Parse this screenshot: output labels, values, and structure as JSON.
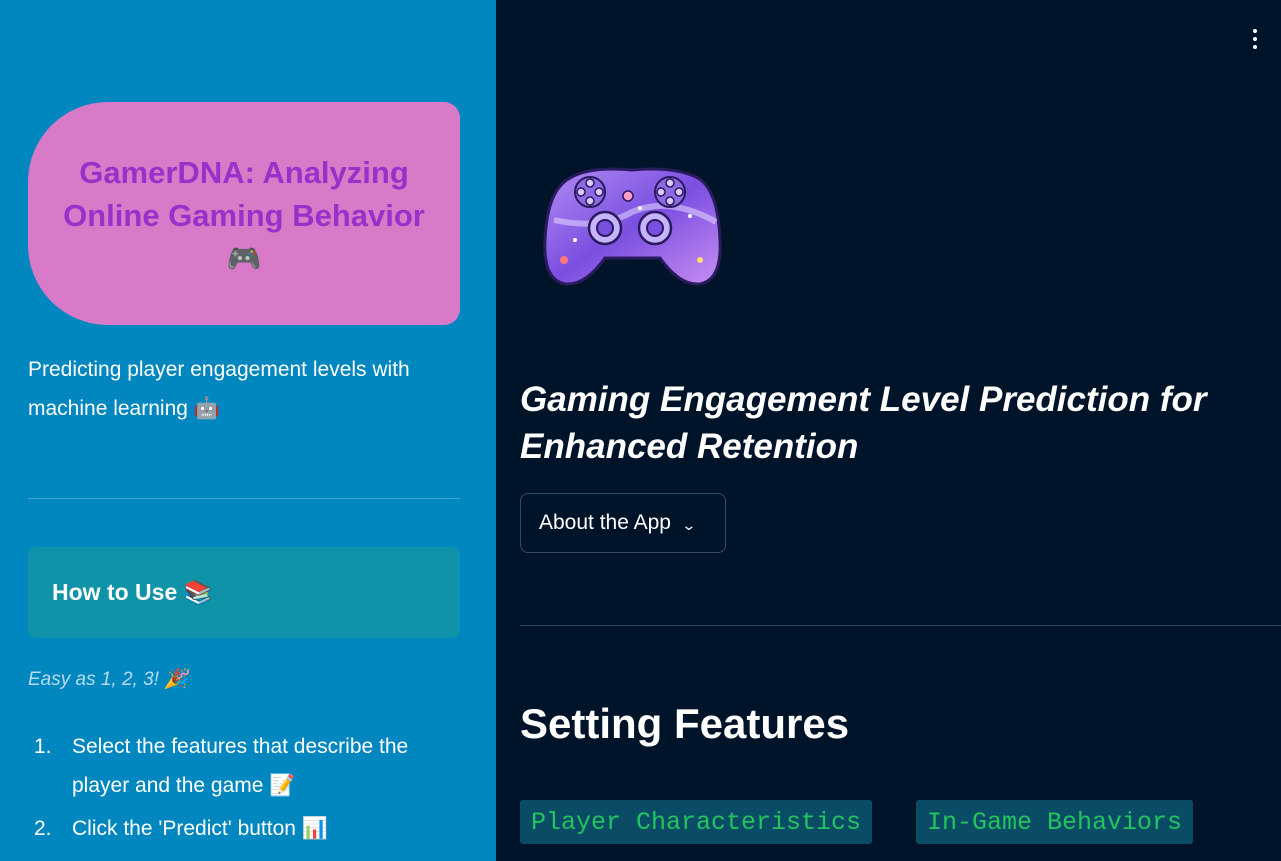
{
  "sidebar": {
    "title": "GamerDNA: Analyzing Online Gaming Behavior",
    "title_emoji": "🎮",
    "subtitle": "Predicting player engagement levels with machine learning 🤖",
    "howto_title": "How to Use 📚",
    "easy_text": "Easy as 1, 2, 3! 🎉",
    "steps": [
      {
        "num": "1.",
        "text": "Select the features that describe the player and the game 📝"
      },
      {
        "num": "2.",
        "text": "Click the 'Predict' button 📊"
      }
    ]
  },
  "main": {
    "menu_icon": "vertical-ellipsis-icon",
    "heading": "Gaming Engagement Level Prediction for Enhanced Retention",
    "about_label": "About the App",
    "section_title": "Setting Features",
    "tags": [
      "Player Characteristics",
      "In-Game Behaviors"
    ]
  },
  "colors": {
    "sidebar_bg": "#0087bf",
    "main_bg": "#001429",
    "title_card": "#d97ac8",
    "title_text": "#9b2fc9",
    "howto_card": "#0e93a9",
    "tag_bg": "#0a4b66",
    "tag_text": "#21c55d"
  }
}
